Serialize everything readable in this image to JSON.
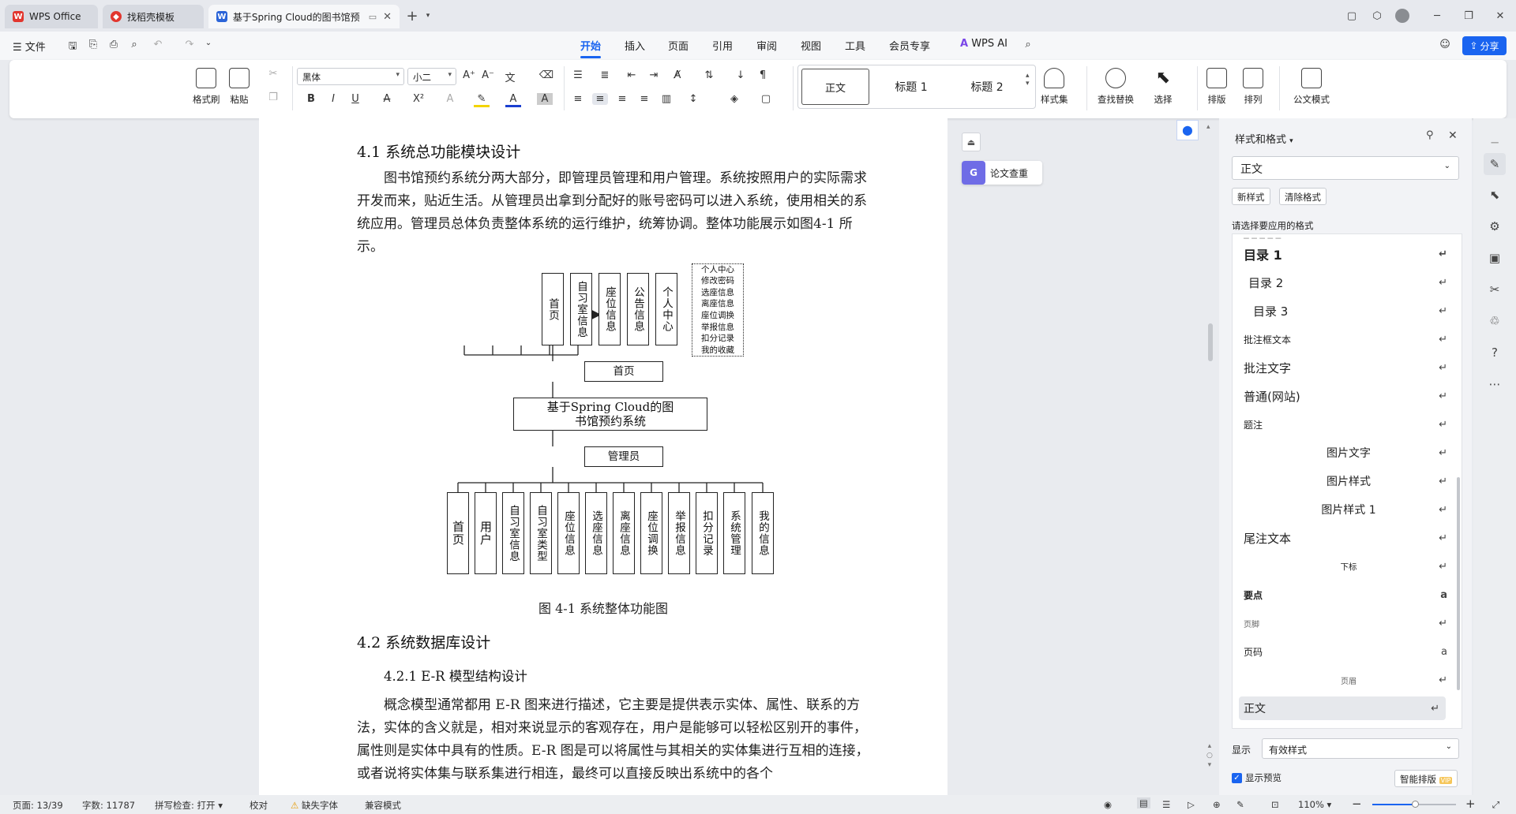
{
  "titlebar": {
    "tabs": [
      {
        "label": "WPS Office"
      },
      {
        "label": "找稻壳模板"
      },
      {
        "label": "基于Spring Cloud的图书馆预"
      }
    ]
  },
  "menubar": {
    "file_label": "文件",
    "tabs": [
      "开始",
      "插入",
      "页面",
      "引用",
      "审阅",
      "视图",
      "工具",
      "会员专享"
    ],
    "ai_label": "WPS AI",
    "share_label": "分享"
  },
  "ribbon": {
    "format_painter": "格式刷",
    "paste": "粘贴",
    "font_name": "黑体",
    "font_size": "小二",
    "styles": [
      "正文",
      "标题 1",
      "标题 2"
    ],
    "style_set": "样式集",
    "find_replace": "查找替换",
    "select": "选择",
    "layout": "排版",
    "arrange": "排列",
    "official": "公文模式"
  },
  "document": {
    "heading_41": "4.1 系统总功能模块设计",
    "para_41": "图书馆预约系统分两大部分，即管理员管理和用户管理。系统按照用户的实际需求开发而来，贴近生活。从管理员出拿到分配好的账号密码可以进入系统，使用相关的系统应用。管理员总体负责整体系统的运行维护，统筹协调。整体功能展示如图4-1 所示。",
    "diagram": {
      "user_modules": [
        "首页",
        "自习室信息",
        "座位信息",
        "公告信息",
        "个人中心"
      ],
      "personal_center_items": [
        "个人中心",
        "修改密码",
        "选座信息",
        "离座信息",
        "座位调换",
        "举报信息",
        "扣分记录",
        "我的收藏"
      ],
      "home_node": "首页",
      "system_node": "基于Spring Cloud的图书馆预约系统",
      "admin_node": "管理员",
      "admin_modules": [
        "首页",
        "用户",
        "自习室信息",
        "自习室类型",
        "座位信息",
        "选座信息",
        "离座信息",
        "座位调换",
        "举报信息",
        "扣分记录",
        "系统管理",
        "我的信息"
      ]
    },
    "caption": "图 4-1  系统整体功能图",
    "heading_42": "4.2 系统数据库设计",
    "heading_421": "4.2.1  E-R 模型结构设计",
    "para_421": "概念模型通常都用 E-R 图来进行描述，它主要是提供表示实体、属性、联系的方法，实体的含义就是，相对来说显示的客观存在，用户是能够可以轻松区别开的事件，属性则是实体中具有的性质。E-R 图是可以将属性与其相关的实体集进行互相的连接，或者说将实体集与联系集进行相连，最终可以直接反映出系统中的各个"
  },
  "sidetools": {
    "plagiarism_label": "论文查重"
  },
  "stylepanel": {
    "title": "样式和格式",
    "current_style": "正文",
    "new_style": "新样式",
    "clear_format": "清除格式",
    "prompt": "请选择要应用的格式",
    "items": [
      "目录 1",
      "目录 2",
      "目录 3",
      "批注框文本",
      "批注文字",
      "普通(网站)",
      "题注",
      "图片文字",
      "图片样式",
      "图片样式 1",
      "尾注文本",
      "下标",
      "要点",
      "页脚",
      "页码",
      "页眉",
      "正文"
    ],
    "show_label": "显示",
    "show_value": "有效样式",
    "preview_label": "显示预览",
    "smart_layout": "智能排版"
  },
  "statusbar": {
    "page": "页面: 13/39",
    "words": "字数: 11787",
    "spell": "拼写检查: 打开",
    "proof": "校对",
    "missing_font": "缺失字体",
    "compat": "兼容模式",
    "zoom": "110%"
  },
  "colors": {
    "accent": "#1a64f0",
    "wps_red": "#e2362e"
  }
}
